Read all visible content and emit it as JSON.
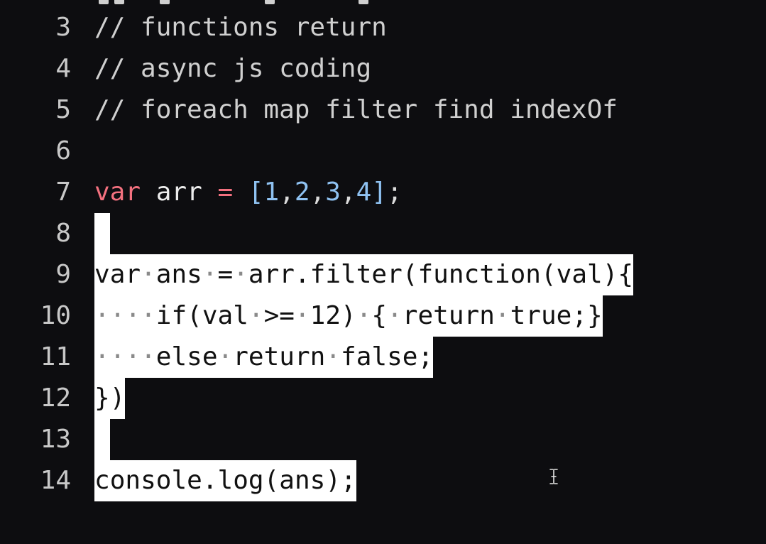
{
  "editor": {
    "lines": [
      {
        "num": "3",
        "text": "// functions return"
      },
      {
        "num": "4",
        "text": "// async js coding"
      },
      {
        "num": "5",
        "text": "// foreach map filter find indexOf"
      },
      {
        "num": "6",
        "text": ""
      },
      {
        "num": "7",
        "tokens": {
          "kw": "var",
          "ident": "arr",
          "op": "=",
          "lb": "[",
          "n1": "1",
          "c1": ",",
          "n2": "2",
          "c2": ",",
          "n3": "3",
          "c3": ",",
          "n4": "4",
          "rb": "]",
          "semi": ";"
        }
      },
      {
        "num": "8",
        "text": ""
      },
      {
        "num": "9",
        "text": "var·ans·=·arr.filter(function(val){"
      },
      {
        "num": "10",
        "text": "····if(val·>=·12)·{·return·true;}"
      },
      {
        "num": "11",
        "text": "····else·return·false;"
      },
      {
        "num": "12",
        "text": "})"
      },
      {
        "num": "13",
        "text": ""
      },
      {
        "num": "14",
        "text": "console.log(ans);"
      }
    ]
  },
  "colors": {
    "background": "#0d0d10",
    "keyword": "#f3717f",
    "number": "#8fc2f2",
    "selection": "#ffffff"
  }
}
